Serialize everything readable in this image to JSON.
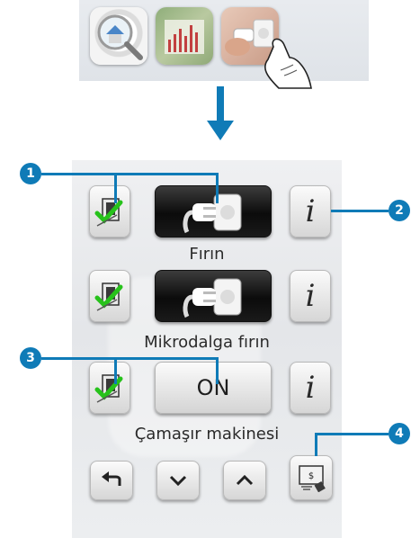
{
  "colors": {
    "accent": "#0f7bb7",
    "check": "#27c21b",
    "dark_button": "#111111"
  },
  "thumbnails": [
    {
      "icon": "magnifier-house-icon"
    },
    {
      "icon": "consumption-chart-icon"
    },
    {
      "icon": "plug-load-icon"
    }
  ],
  "devices": [
    {
      "name": "Fırın",
      "state": "plug-icon",
      "info": "i"
    },
    {
      "name": "Mikrodalga fırın",
      "state": "plug-icon",
      "info": "i"
    },
    {
      "name": "Çamaşır makinesi",
      "state": "ON",
      "info": "i"
    }
  ],
  "callouts": [
    "1",
    "2",
    "3",
    "4"
  ],
  "nav": {
    "back": "back-arrow-icon",
    "down": "chevron-down-icon",
    "up": "chevron-up-icon",
    "tariff": "tariff-icon"
  }
}
